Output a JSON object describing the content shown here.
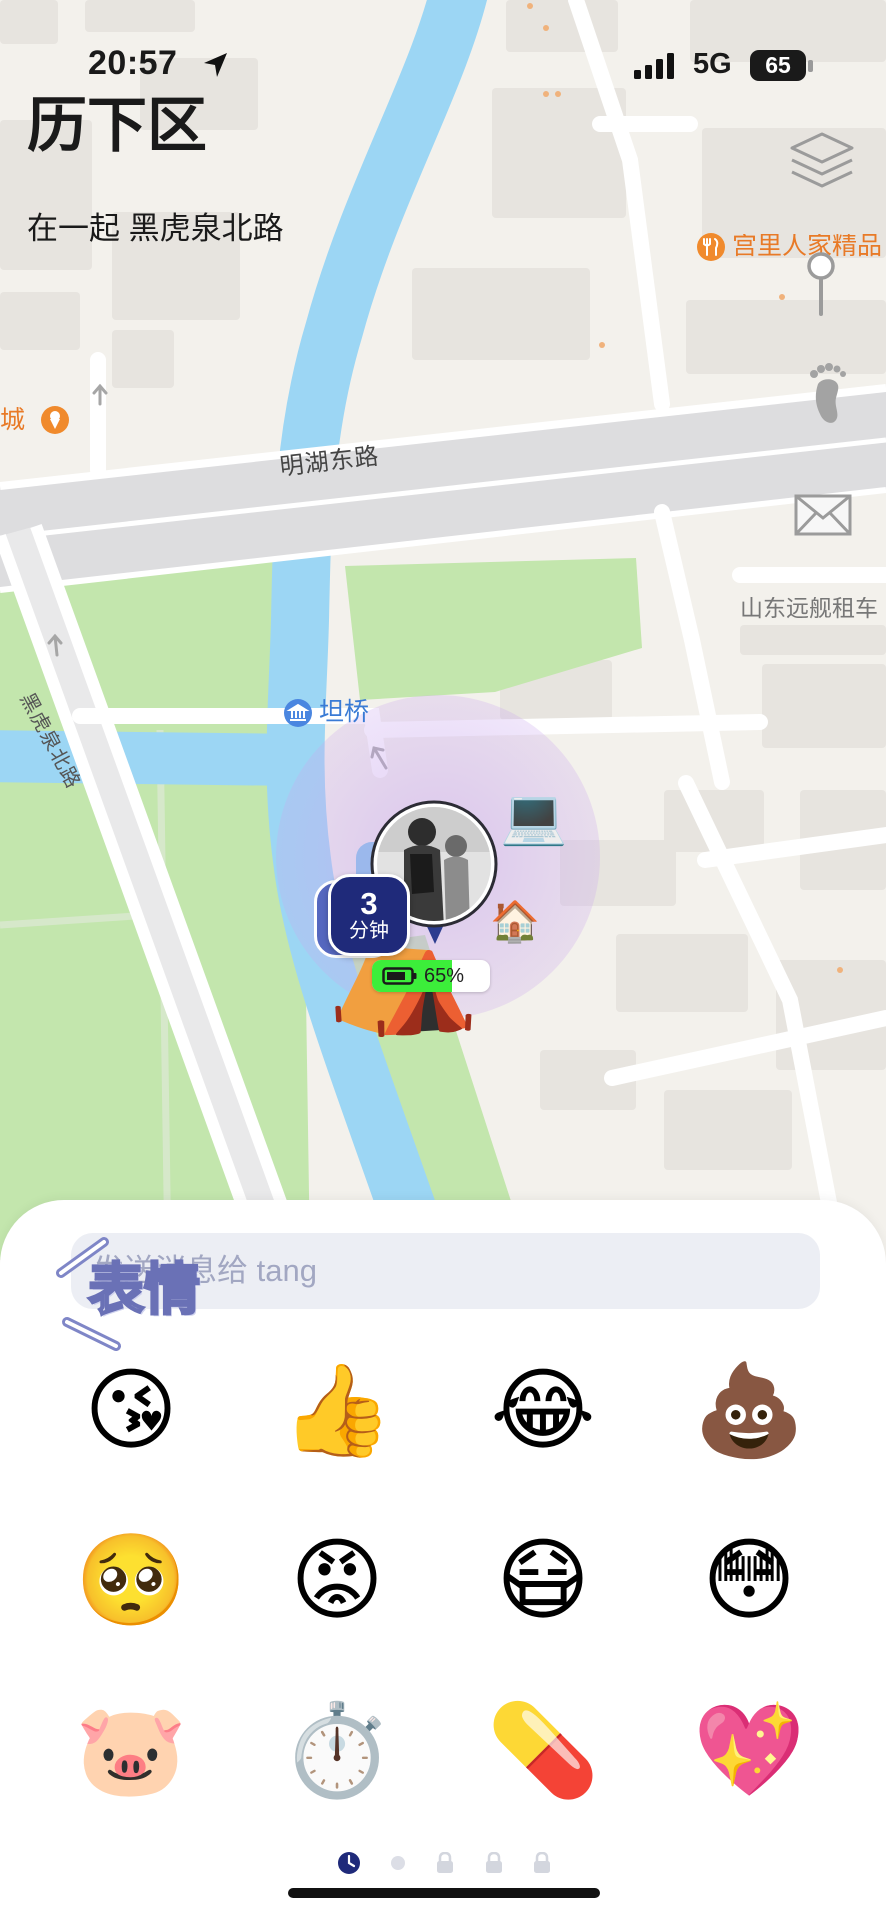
{
  "status_bar": {
    "time": "20:57",
    "network": "5G",
    "battery": "65"
  },
  "header": {
    "district": "历下区",
    "status": "在一起 黑虎泉北路"
  },
  "map_controls": {
    "layers": "layers-icon",
    "pin": "pin-icon",
    "footprints": "footprint-icon",
    "messages": "envelope-icon"
  },
  "map_labels": {
    "poi_restaurant": "宫里人家精品",
    "poi_left": "城",
    "road_minghu": "明湖东路",
    "poi_car_rental": "山东远舰租车",
    "poi_bridge": "坦桥",
    "road_heihuquan": "黑虎泉北路"
  },
  "marker": {
    "eta_value": "3",
    "eta_unit": "分钟",
    "battery": "65%",
    "device": "💻",
    "places": [
      "🏠",
      "⛺"
    ]
  },
  "panel": {
    "input_placeholder": "发送消息给 tang",
    "title": "表情",
    "emojis": [
      "😘",
      "👍",
      "😂",
      "💩",
      "🥺",
      "😡",
      "😷",
      "😳",
      "🐷",
      "⏱️",
      "💊",
      "💖"
    ],
    "pages": [
      {
        "icon": "clock-icon",
        "active": true
      },
      {
        "icon": "dot",
        "active": false
      },
      {
        "icon": "lock-icon",
        "active": false
      },
      {
        "icon": "lock-icon",
        "active": false
      },
      {
        "icon": "lock-icon",
        "active": false
      }
    ]
  },
  "colors": {
    "accent_navy": "#1f2a7a",
    "battery_green": "#3cee3a",
    "poi_orange": "#e87a27",
    "poi_blue": "#3a7bd5",
    "river": "#9cd6f4",
    "park": "#c3e6ad",
    "title_outline": "#6a71b6"
  }
}
